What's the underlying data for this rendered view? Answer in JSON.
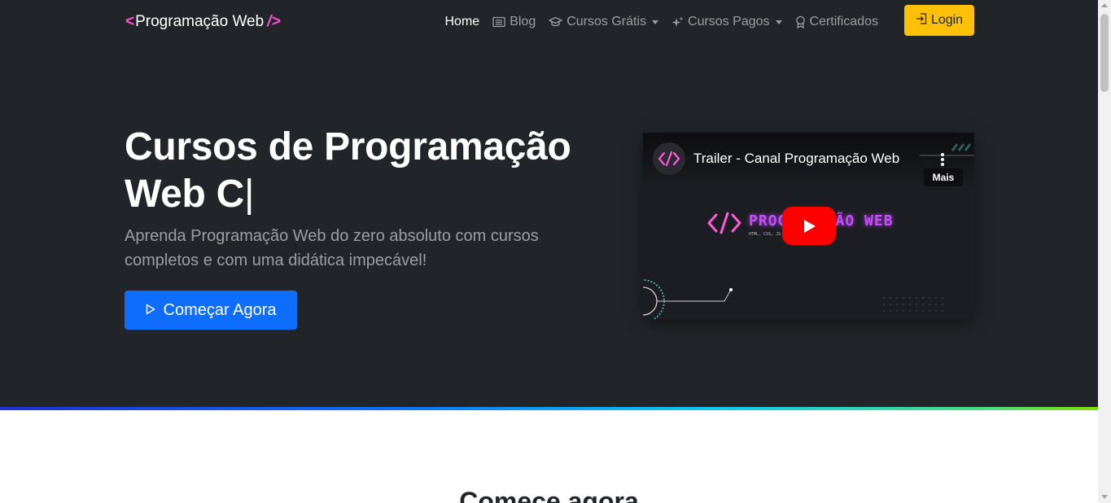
{
  "navbar": {
    "brand_left": "<",
    "brand_name": "Programação Web",
    "brand_right": "/>",
    "items": [
      {
        "label": "Home",
        "icon": "none",
        "active": true
      },
      {
        "label": "Blog",
        "icon": "newspaper-icon"
      },
      {
        "label": "Cursos Grátis",
        "icon": "mortarboard-icon",
        "dropdown": true
      },
      {
        "label": "Cursos Pagos",
        "icon": "stars-icon",
        "dropdown": true
      },
      {
        "label": "Certificados",
        "icon": "award-icon"
      }
    ],
    "login_label": "Login"
  },
  "hero": {
    "title_line1": "Cursos de Programação",
    "title_line2": "Web C",
    "title_cursor": "|",
    "subtitle": "Aprenda Programação Web do zero absoluto com cursos completos e com uma didática impecável!",
    "cta_label": "Começar Agora"
  },
  "video": {
    "title": "Trailer - Canal Programação Web",
    "more_label": "Mais",
    "art_title": "PROGRAMAÇÃO WEB",
    "art_subtitle": "HTML, CSS, JS - prof. Dimitri"
  },
  "section": {
    "heading": "Comece agora"
  },
  "colors": {
    "hero_bg": "#212529",
    "primary": "#0d6efd",
    "warning": "#ffc107",
    "brand_accent": "#ff4fcf",
    "youtube_red": "#ff0000"
  }
}
